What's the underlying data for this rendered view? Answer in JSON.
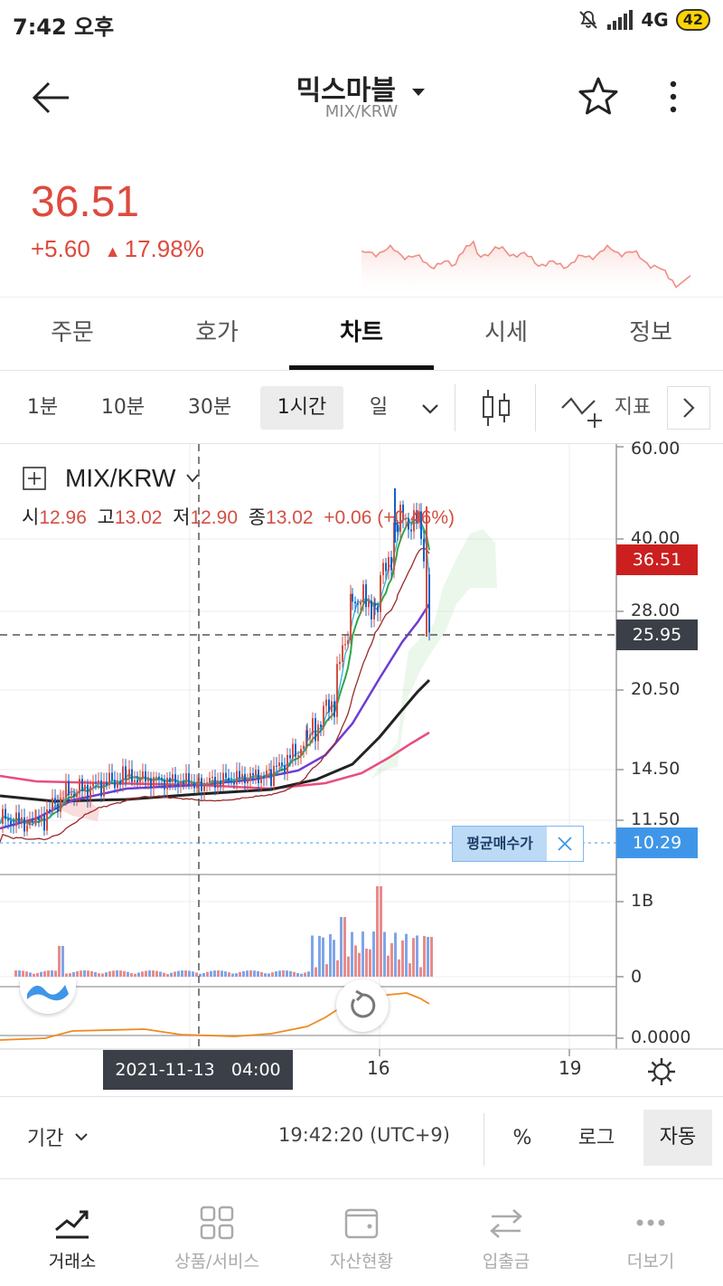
{
  "status_bar": {
    "time": "7:42 오후",
    "network": "4G",
    "battery": "42"
  },
  "header": {
    "title": "믹스마블",
    "pair": "MIX/KRW"
  },
  "price": {
    "current": "36.51",
    "change": "+5.60",
    "change_pct": "17.98%"
  },
  "tabs": [
    {
      "label": "주문"
    },
    {
      "label": "호가"
    },
    {
      "label": "차트"
    },
    {
      "label": "시세"
    },
    {
      "label": "정보"
    }
  ],
  "timeframes": {
    "items": [
      "1분",
      "10분",
      "30분",
      "1시간",
      "일"
    ],
    "selected": "1시간",
    "indicator_label": "지표"
  },
  "chart": {
    "symbol": "MIX/KRW",
    "ohlc": {
      "open_label": "시",
      "open": "12.96",
      "high_label": "고",
      "high": "13.02",
      "low_label": "저",
      "low": "12.90",
      "close_label": "종",
      "close": "13.02",
      "change": "+0.06",
      "change_pct": "(+0.46%)"
    },
    "price_axis_ticks": [
      "60.00",
      "40.00",
      "28.00",
      "20.50",
      "14.50",
      "11.50"
    ],
    "volume_axis_ticks": [
      "1B",
      "0"
    ],
    "osc_axis_ticks": [
      "0.0000"
    ],
    "last_price_tag": "36.51",
    "cursor_price_tag": "25.95",
    "avg_buy_label": "평균매수가",
    "avg_buy_price": "10.29",
    "cursor_time": "2021-11-13   04:00",
    "x_ticks": [
      "16",
      "19"
    ],
    "colors": {
      "up": "#d24f45",
      "down": "#1261c4",
      "accent": "#dd4b3e",
      "avg_line": "#3f96e8"
    }
  },
  "chart_data": {
    "type": "candlestick",
    "x_labels": [
      "16",
      "19"
    ],
    "y_log_scale": true,
    "y_ticks": [
      60,
      40,
      28,
      20.5,
      14.5,
      11.5
    ],
    "last_price": 36.51,
    "avg_buy_price": 10.29,
    "crosshair_price": 25.95,
    "crosshair_time": "2021-11-13 04:00"
  },
  "bottom_bar": {
    "period_label": "기간",
    "clock": "19:42:20 (UTC+9)",
    "pct": "%",
    "log": "로그",
    "auto": "자동"
  },
  "bottom_nav": [
    {
      "label": "거래소",
      "icon": "chart-trend-icon"
    },
    {
      "label": "상품/서비스",
      "icon": "grid-icon"
    },
    {
      "label": "자산현황",
      "icon": "wallet-icon"
    },
    {
      "label": "입출금",
      "icon": "transfer-icon"
    },
    {
      "label": "더보기",
      "icon": "more-dots-icon"
    }
  ]
}
